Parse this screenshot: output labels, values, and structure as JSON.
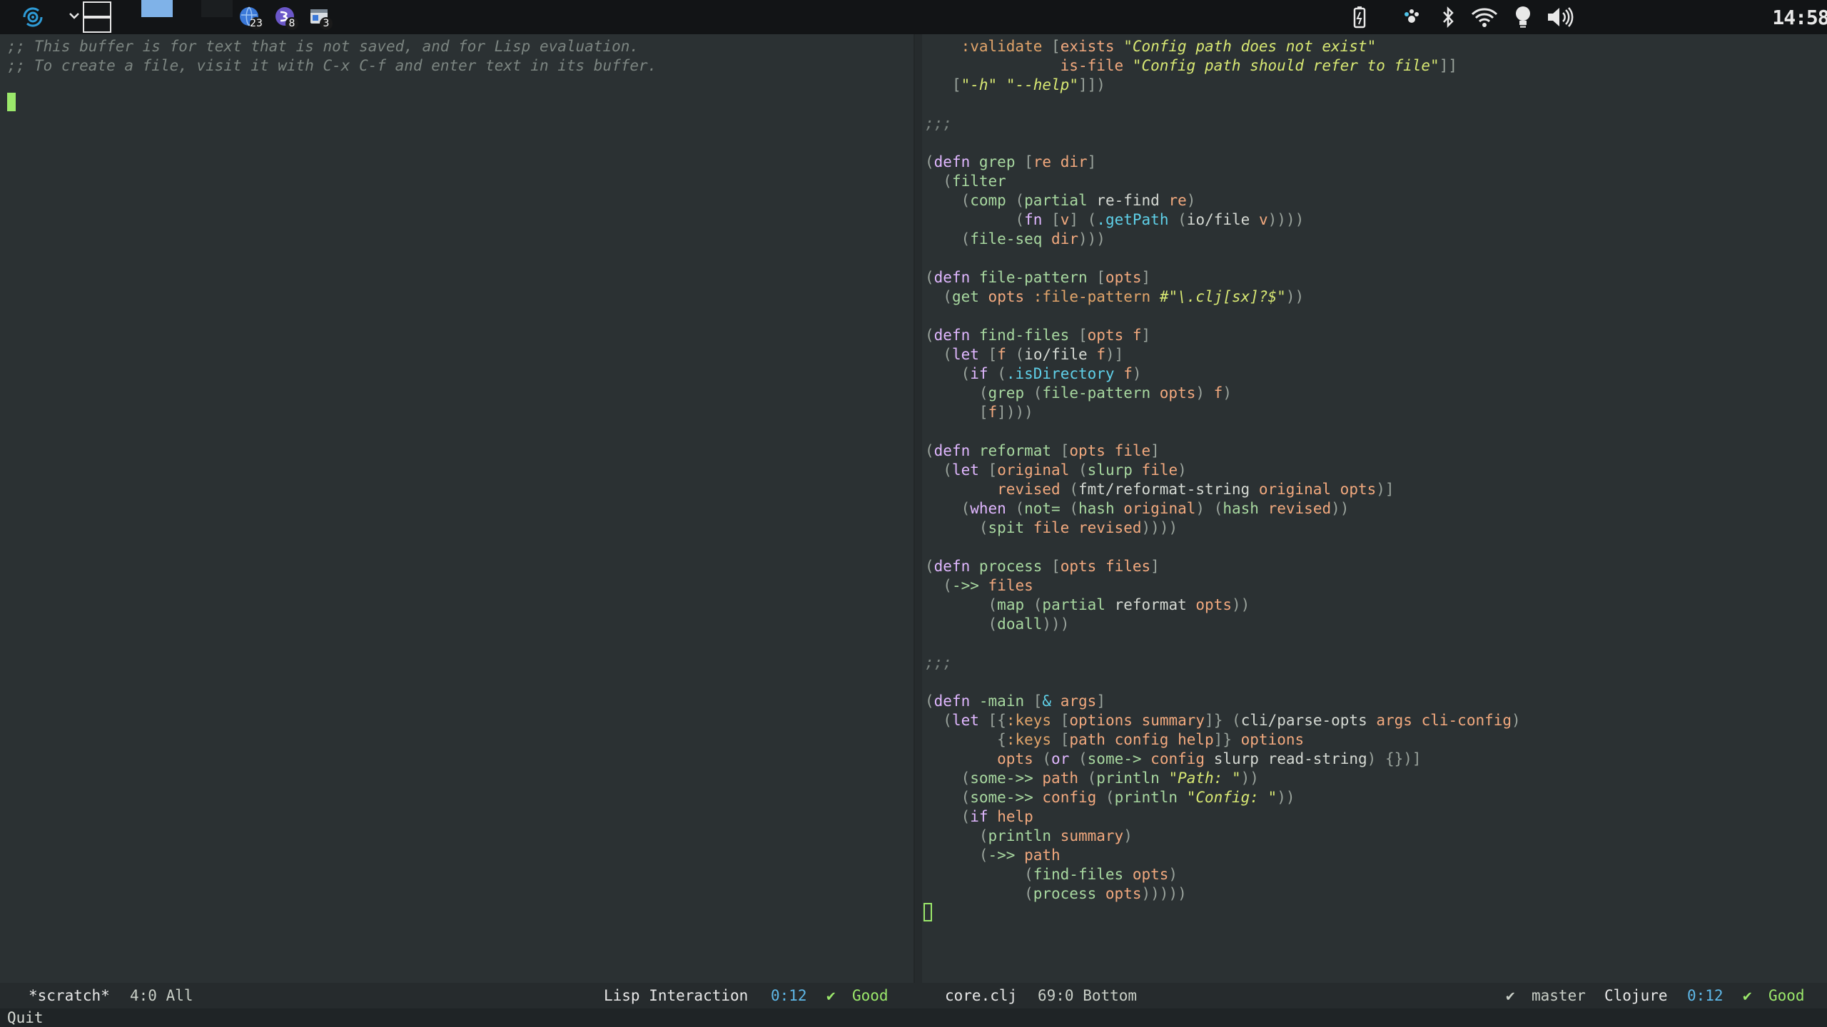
{
  "panel": {
    "launcher_icon": "stylized-swirl-logo-icon",
    "workspace_chevron": "chevron-down-icon",
    "task_badges": [
      {
        "icon": "globe-app-icon",
        "count": "23"
      },
      {
        "icon": "emacs-app-icon",
        "count": "8"
      },
      {
        "icon": "window-app-icon",
        "count": "3"
      }
    ],
    "tray_icons": [
      "battery-icon",
      "paw-icon",
      "bluetooth-icon",
      "wifi-icon",
      "lightbulb-icon",
      "volume-icon"
    ],
    "clock": "14:58"
  },
  "left_pane": {
    "lines": [
      ";; This buffer is for text that is not saved, and for Lisp evaluation.",
      ";; To create a file, visit it with C-x C-f and enter text in its buffer."
    ]
  },
  "right_pane": {
    "code_lines": [
      "    :validate [exists \"Config path does not exist\"",
      "               is-file \"Config path should refer to file\"]]",
      "   [\"-h\" \"--help\"]])",
      "",
      ";;;",
      "",
      "(defn grep [re dir]",
      "  (filter",
      "    (comp (partial re-find re)",
      "          (fn [v] (.getPath (io/file v))))",
      "    (file-seq dir)))",
      "",
      "(defn file-pattern [opts]",
      "  (get opts :file-pattern #\"\\.clj[sx]?$\"))",
      "",
      "(defn find-files [opts f]",
      "  (let [f (io/file f)]",
      "    (if (.isDirectory f)",
      "      (grep (file-pattern opts) f)",
      "      [f])))",
      "",
      "(defn reformat [opts file]",
      "  (let [original (slurp file)",
      "        revised (fmt/reformat-string original opts)]",
      "    (when (not= (hash original) (hash revised))",
      "      (spit file revised))))",
      "",
      "(defn process [opts files]",
      "  (->> files",
      "       (map (partial reformat opts))",
      "       (doall)))",
      "",
      ";;;",
      "",
      "(defn -main [& args]",
      "  (let [{:keys [options summary]} (cli/parse-opts args cli-config)",
      "        {:keys [path config help]} options",
      "        opts (or (some-> config slurp read-string) {})]",
      "    (some->> path (println \"Path: \"))",
      "    (some->> config (println \"Config: \"))",
      "    (if help",
      "      (println summary)",
      "      (->> path",
      "           (find-files opts)",
      "           (process opts)))))"
    ]
  },
  "modeline_left": {
    "buffer": "*scratch*",
    "position": "4:0 All",
    "mode": "Lisp Interaction",
    "time": "0:12",
    "check": "✔",
    "status": "Good"
  },
  "modeline_right": {
    "buffer": "core.clj",
    "position": "69:0 Bottom",
    "vc_check": "✔",
    "branch": "master",
    "mode": "Clojure",
    "time": "0:12",
    "check": "✔",
    "status": "Good"
  },
  "minibuffer": {
    "text": "Quit"
  },
  "colors": {
    "background": "#2b3133",
    "panel": "#121416",
    "cursor": "#9be86b",
    "keyword": "#e8c88a",
    "function": "#a8d8a0",
    "string": "#d8e873",
    "variable": "#5fd0e8"
  }
}
